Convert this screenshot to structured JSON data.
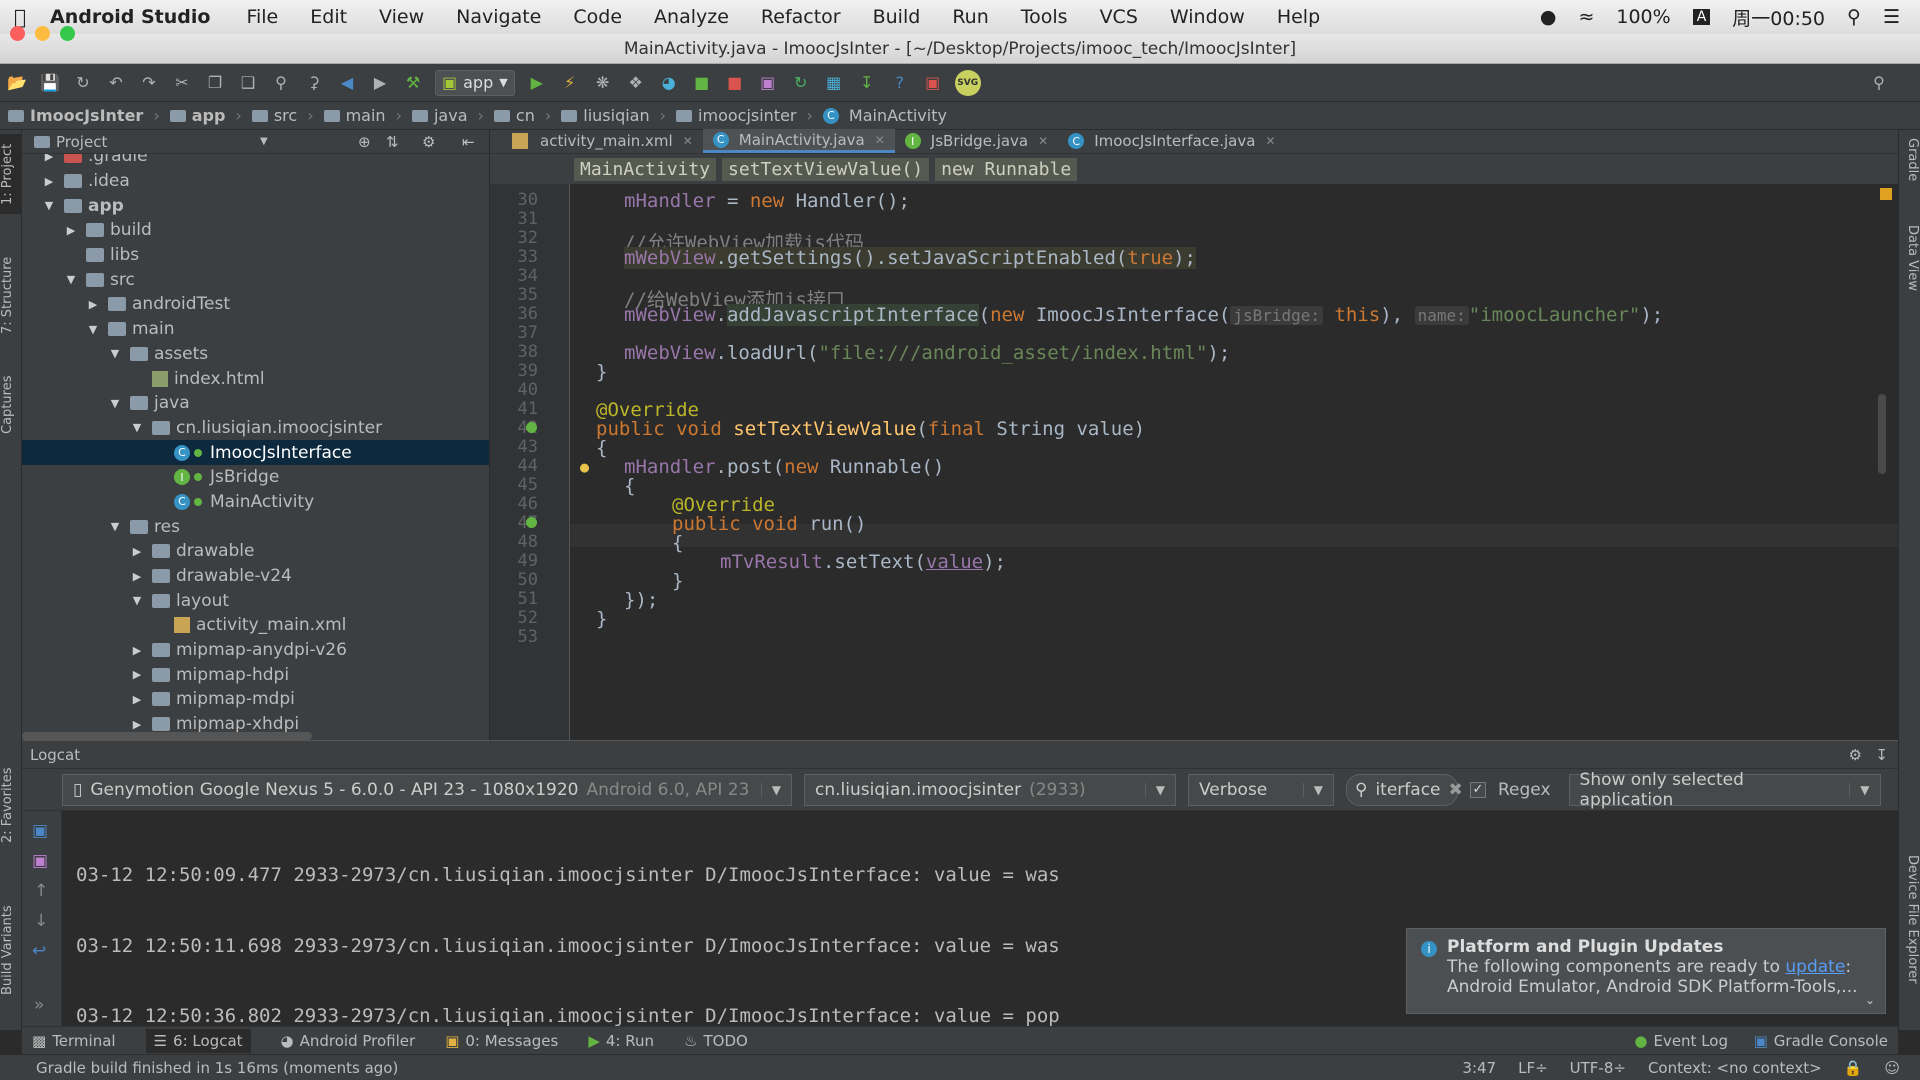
{
  "menubar": {
    "app": "Android Studio",
    "items": [
      "File",
      "Edit",
      "View",
      "Navigate",
      "Code",
      "Analyze",
      "Refactor",
      "Build",
      "Run",
      "Tools",
      "VCS",
      "Window",
      "Help"
    ],
    "battery": "100%",
    "input_method": "A",
    "clock": "周一00:50"
  },
  "titlebar": {
    "title": "MainActivity.java - ImoocJsInter - [~/Desktop/Projects/imooc_tech/ImoocJsInter]"
  },
  "toolbar": {
    "run_config": "app",
    "svg_label": "SVG"
  },
  "navbar": {
    "crumbs": [
      "ImoocJsInter",
      "app",
      "src",
      "main",
      "java",
      "cn",
      "liusiqian",
      "imoocjsinter",
      "MainActivity"
    ]
  },
  "left_strip": {
    "project": "1: Project",
    "structure": "7: Structure",
    "captures": "Captures",
    "favorites": "2: Favorites",
    "build_variants": "Build Variants"
  },
  "right_strip": {
    "gradle": "Gradle",
    "data_view": "Data View",
    "device_explorer": "Device File Explorer"
  },
  "project": {
    "title": "Project",
    "tree": [
      {
        "label": ".gradle",
        "indent": 1,
        "type": "folder-orange",
        "arrow": "▶"
      },
      {
        "label": ".idea",
        "indent": 1,
        "type": "folder",
        "arrow": "▶"
      },
      {
        "label": "app",
        "indent": 1,
        "type": "folder",
        "arrow": "▼",
        "bold": true
      },
      {
        "label": "build",
        "indent": 2,
        "type": "folder",
        "arrow": "▶"
      },
      {
        "label": "libs",
        "indent": 2,
        "type": "folder",
        "arrow": ""
      },
      {
        "label": "src",
        "indent": 2,
        "type": "folder",
        "arrow": "▼"
      },
      {
        "label": "androidTest",
        "indent": 3,
        "type": "folder",
        "arrow": "▶"
      },
      {
        "label": "main",
        "indent": 3,
        "type": "folder",
        "arrow": "▼"
      },
      {
        "label": "assets",
        "indent": 4,
        "type": "folder",
        "arrow": "▼"
      },
      {
        "label": "index.html",
        "indent": 5,
        "type": "html",
        "arrow": ""
      },
      {
        "label": "java",
        "indent": 4,
        "type": "folder",
        "arrow": "▼"
      },
      {
        "label": "cn.liusiqian.imoocjsinter",
        "indent": 5,
        "type": "folder",
        "arrow": "▼"
      },
      {
        "label": "ImoocJsInterface",
        "indent": 6,
        "type": "class",
        "arrow": "",
        "selected": true
      },
      {
        "label": "JsBridge",
        "indent": 6,
        "type": "interface",
        "arrow": ""
      },
      {
        "label": "MainActivity",
        "indent": 6,
        "type": "class",
        "arrow": ""
      },
      {
        "label": "res",
        "indent": 4,
        "type": "folder",
        "arrow": "▼"
      },
      {
        "label": "drawable",
        "indent": 5,
        "type": "folder",
        "arrow": "▶"
      },
      {
        "label": "drawable-v24",
        "indent": 5,
        "type": "folder",
        "arrow": "▶"
      },
      {
        "label": "layout",
        "indent": 5,
        "type": "folder",
        "arrow": "▼"
      },
      {
        "label": "activity_main.xml",
        "indent": 6,
        "type": "xml",
        "arrow": ""
      },
      {
        "label": "mipmap-anydpi-v26",
        "indent": 5,
        "type": "folder",
        "arrow": "▶"
      },
      {
        "label": "mipmap-hdpi",
        "indent": 5,
        "type": "folder",
        "arrow": "▶"
      },
      {
        "label": "mipmap-mdpi",
        "indent": 5,
        "type": "folder",
        "arrow": "▶"
      },
      {
        "label": "mipmap-xhdpi",
        "indent": 5,
        "type": "folder",
        "arrow": "▶"
      }
    ]
  },
  "editor": {
    "tabs": [
      {
        "label": "activity_main.xml",
        "active": false
      },
      {
        "label": "MainActivity.java",
        "active": true
      },
      {
        "label": "JsBridge.java",
        "active": false
      },
      {
        "label": "ImoocJsInterface.java",
        "active": false
      }
    ],
    "breadcrumbs": [
      "MainActivity",
      "setTextViewValue()",
      "new Runnable"
    ],
    "line_numbers": [
      30,
      31,
      32,
      33,
      34,
      35,
      36,
      37,
      38,
      39,
      40,
      41,
      42,
      43,
      44,
      45,
      46,
      47,
      48,
      49,
      50,
      51,
      52,
      53
    ],
    "code": {
      "l30a": "mHandler",
      "l30b": " = ",
      "l30c": "new ",
      "l30d": "Handler();",
      "l32": "//允许WebView加载js代码",
      "l33a": "mWebView",
      "l33b": ".getSettings().setJavaScriptEnabled(",
      "l33c": "true",
      "l33d": ");",
      "l35": "//给WebView添加js接口",
      "l36a": "mWebView",
      "l36b": ".",
      "l36c": "addJavascriptInterface",
      "l36d": "(",
      "l36e": "new ",
      "l36f": "ImoocJsInterface(",
      "l36g": "jsBridge:",
      "l36h": " this",
      "l36i": "),",
      "l36j": "name:",
      "l36k": "\"imoocLauncher\"",
      "l36l": ");",
      "l38a": "mWebView",
      "l38b": ".loadUrl(",
      "l38c": "\"file:///android_asset/index.html\"",
      "l38d": ");",
      "l39": "}",
      "l41": "@Override",
      "l42a": "public void ",
      "l42b": "setTextViewValue",
      "l42c": "(",
      "l42d": "final ",
      "l42e": "String value)",
      "l43": "{",
      "l44a": "mHandler",
      "l44b": ".post(",
      "l44c": "new ",
      "l44d": "Runnable()",
      "l45": "{",
      "l46": "@Override",
      "l47a": "public void ",
      "l47b": "run",
      "l47c": "()",
      "l48": "{",
      "l49a": "mTvResult",
      "l49b": ".setText(",
      "l49c": "value",
      "l49d": ");",
      "l50": "}",
      "l51": "});",
      "l52": "}"
    }
  },
  "logcat": {
    "title": "Logcat",
    "device": "Genymotion Google Nexus 5 - 6.0.0 - API 23 - 1080x1920",
    "device_api": "Android 6.0, API 23",
    "process": "cn.liusiqian.imoocjsinter",
    "pid": "(2933)",
    "level": "Verbose",
    "filter": "iterface",
    "regex_label": "Regex",
    "show_only": "Show only selected application",
    "lines": [
      "03-12 12:50:09.477 2933-2973/cn.liusiqian.imoocjsinter D/ImoocJsInterface: value = was",
      "03-12 12:50:11.698 2933-2973/cn.liusiqian.imoocjsinter D/ImoocJsInterface: value = was",
      "03-12 12:50:36.802 2933-2973/cn.liusiqian.imoocjsinter D/ImoocJsInterface: value = pop"
    ]
  },
  "notification": {
    "title": "Platform and Plugin Updates",
    "body_pre": "The following components are ready to ",
    "link": "update",
    "body_post": ":",
    "line2": "Android Emulator, Android SDK Platform-Tools,..."
  },
  "bottom_tabs": [
    {
      "label": "Terminal"
    },
    {
      "label": "6: Logcat",
      "active": true
    },
    {
      "label": "Android Profiler"
    },
    {
      "label": "0: Messages"
    },
    {
      "label": "4: Run"
    },
    {
      "label": "TODO"
    }
  ],
  "bottom_right": {
    "event_log": "Event Log",
    "gradle_console": "Gradle Console"
  },
  "status": {
    "message": "Gradle build finished in 1s 16ms (moments ago)",
    "position": "3:47",
    "line_sep": "LF÷",
    "encoding": "UTF-8÷",
    "context": "Context: <no context>"
  }
}
